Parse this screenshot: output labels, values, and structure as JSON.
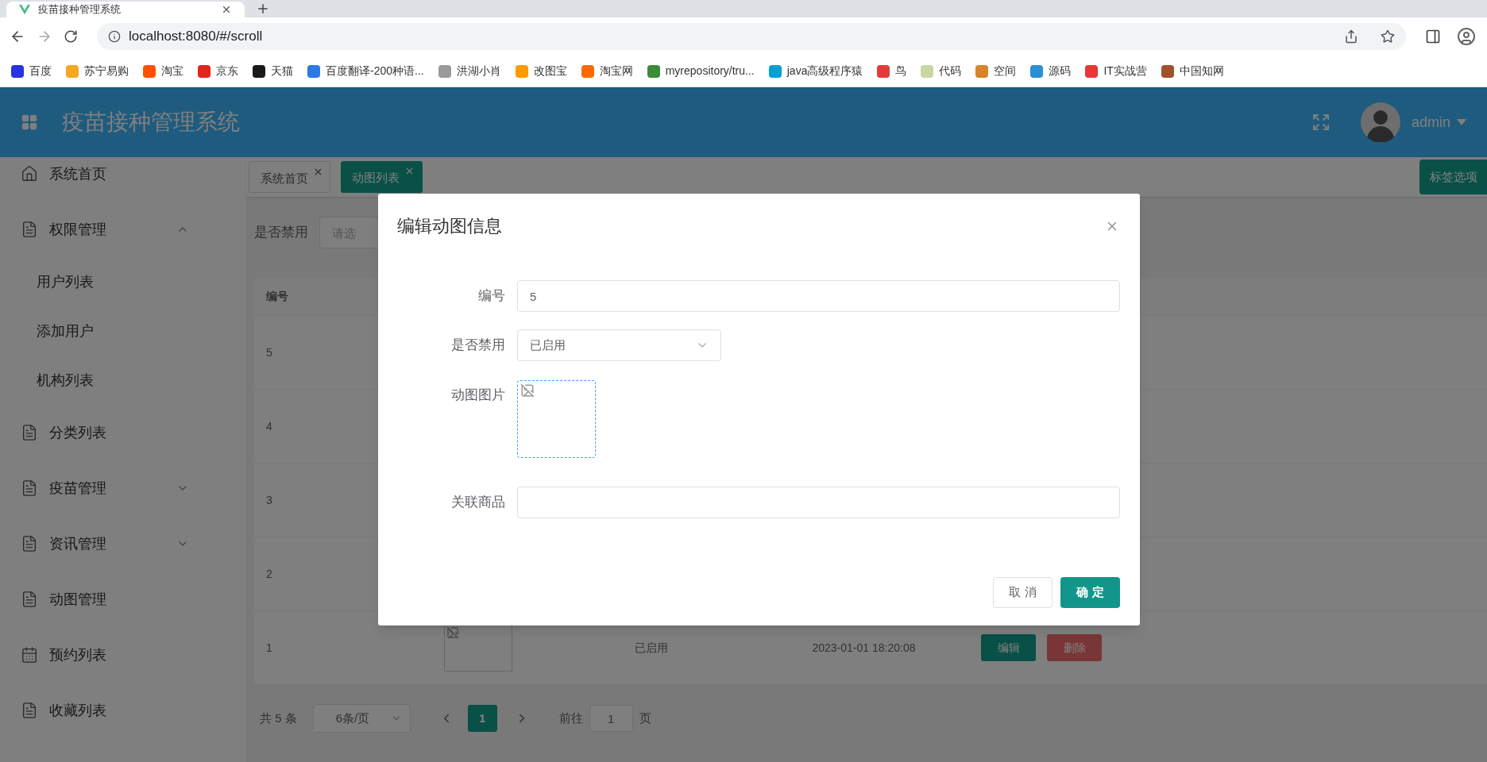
{
  "browser": {
    "tab_title": "疫苗接种管理系统",
    "url": "localhost:8080/#/scroll",
    "bookmarks": [
      {
        "label": "百度",
        "color": "#2932e1"
      },
      {
        "label": "苏宁易购",
        "color": "#f5a623"
      },
      {
        "label": "淘宝",
        "color": "#ff5000"
      },
      {
        "label": "京东",
        "color": "#e1251b"
      },
      {
        "label": "天猫",
        "color": "#1a1a1a"
      },
      {
        "label": "百度翻译-200种语...",
        "color": "#2a7ae2"
      },
      {
        "label": "洪湖小肖",
        "color": "#9a9a9a"
      },
      {
        "label": "改图宝",
        "color": "#ff9900"
      },
      {
        "label": "淘宝网",
        "color": "#ff6a00"
      },
      {
        "label": "myrepository/tru...",
        "color": "#3c8a3c"
      },
      {
        "label": "java高级程序猿",
        "color": "#00a1d6"
      },
      {
        "label": "鸟",
        "color": "#e33b3b"
      },
      {
        "label": "代码",
        "color": "#c9d6a3"
      },
      {
        "label": "空间",
        "color": "#d9822b"
      },
      {
        "label": "源码",
        "color": "#2a8fd6"
      },
      {
        "label": "IT实战营",
        "color": "#e53935"
      },
      {
        "label": "中国知网",
        "color": "#a0522d"
      }
    ]
  },
  "header": {
    "title": "疫苗接种管理系统",
    "user": "admin"
  },
  "sidebar": {
    "items": [
      {
        "label": "系统首页",
        "kind": "home"
      },
      {
        "label": "权限管理",
        "kind": "doc",
        "expanded": true,
        "children": [
          {
            "label": "用户列表"
          },
          {
            "label": "添加用户"
          },
          {
            "label": "机构列表"
          }
        ]
      },
      {
        "label": "分类列表",
        "kind": "doc"
      },
      {
        "label": "疫苗管理",
        "kind": "doc",
        "expanded": false
      },
      {
        "label": "资讯管理",
        "kind": "doc",
        "expanded": false
      },
      {
        "label": "动图管理",
        "kind": "doc"
      },
      {
        "label": "预约列表",
        "kind": "calendar"
      },
      {
        "label": "收藏列表",
        "kind": "doc"
      }
    ]
  },
  "tabs": [
    {
      "label": "系统首页",
      "selected": false
    },
    {
      "label": "动图列表",
      "selected": true
    }
  ],
  "tab_options_button": "标签选项",
  "filter": {
    "label": "是否禁用",
    "placeholder": "请选"
  },
  "table": {
    "columns": [
      "编号"
    ],
    "rows": [
      {
        "id": "5"
      },
      {
        "id": "4"
      },
      {
        "id": "3"
      },
      {
        "id": "2"
      },
      {
        "id": "1",
        "thumbnail": true,
        "status": "已启用",
        "time": "2023-01-01 18:20:08",
        "actions": [
          {
            "label": "编辑",
            "kind": "edit"
          },
          {
            "label": "删除",
            "kind": "delete"
          }
        ]
      }
    ]
  },
  "pagination": {
    "total": "共 5 条",
    "page_size": "6条/页",
    "pages": [
      {
        "label": "1",
        "selected": true
      }
    ],
    "goto_label": "前往",
    "goto_value": "1",
    "goto_suffix": "页"
  },
  "dialog": {
    "title": "编辑动图信息",
    "fields": [
      {
        "label": "编号",
        "kind": "input",
        "value": "5"
      },
      {
        "label": "是否禁用",
        "kind": "select",
        "value": "已启用"
      },
      {
        "label": "动图图片",
        "kind": "upload"
      },
      {
        "label": "关联商品",
        "kind": "input"
      }
    ],
    "buttons": [
      {
        "label": "取 消",
        "kind": "secondary"
      },
      {
        "label": "确 定",
        "kind": "primary"
      }
    ]
  }
}
